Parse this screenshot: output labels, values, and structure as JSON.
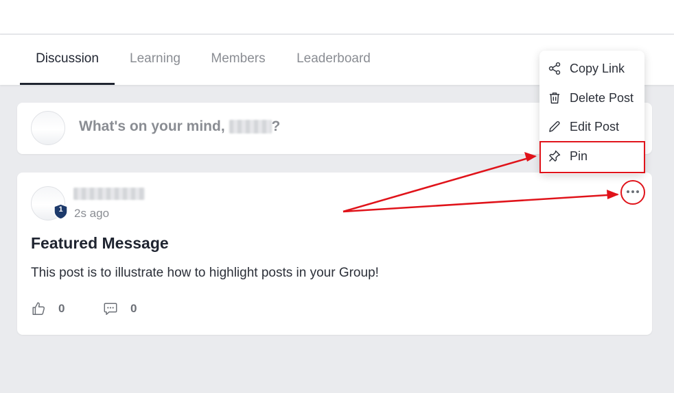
{
  "tabs": [
    {
      "label": "Discussion",
      "active": true
    },
    {
      "label": "Learning",
      "active": false
    },
    {
      "label": "Members",
      "active": false
    },
    {
      "label": "Leaderboard",
      "active": false
    }
  ],
  "composer": {
    "prompt_prefix": "What's on your mind, ",
    "prompt_suffix": "?"
  },
  "post": {
    "author_badge_level": "1",
    "time_ago": "2s ago",
    "title": "Featured Message",
    "body": "This post is to illustrate how to highlight posts in your Group!",
    "like_count": "0",
    "comment_count": "0"
  },
  "post_menu": {
    "items": [
      {
        "label": "Copy Link",
        "icon": "share-icon"
      },
      {
        "label": "Delete Post",
        "icon": "trash-icon"
      },
      {
        "label": "Edit Post",
        "icon": "pencil-icon"
      },
      {
        "label": "Pin",
        "icon": "pin-icon"
      }
    ]
  },
  "colors": {
    "accent": "#1f2430",
    "annotation_red": "#e0131a",
    "badge_navy": "#1d3a6b",
    "background": "#eaebee"
  }
}
